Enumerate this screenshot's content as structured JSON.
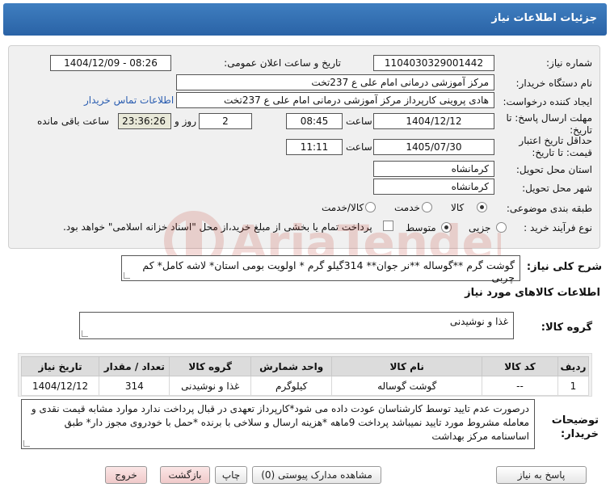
{
  "header": {
    "title": "جزئیات اطلاعات نیاز"
  },
  "form": {
    "need_number_label": "شماره نیاز:",
    "need_number": "1104030329001442",
    "announce_label": "تاریخ و ساعت اعلان عمومی:",
    "announce_value": "1404/12/09 - 08:26",
    "buyer_label": "نام دستگاه خریدار:",
    "buyer_value": "مرکز آموزشی درمانی امام علی ع 237تخت",
    "creator_label": "ایجاد کننده درخواست:",
    "creator_value": "هادی پروینی کارپرداز  مرکز آموزشی درمانی امام علی ع 237تخت",
    "contact_link": "اطلاعات تماس خریدار",
    "deadline_label": "مهلت ارسال پاسخ: تا تاریخ:",
    "deadline_date": "1404/12/12",
    "time_label": "ساعت",
    "deadline_time": "08:45",
    "days_value": "2",
    "days_label": "روز و",
    "remaining_time": "23:36:26",
    "remaining_label": "ساعت باقی مانده",
    "validity_label": "حداقل تاریخ اعتبار قیمت: تا تاریخ:",
    "validity_date": "1405/07/30",
    "validity_time": "11:11",
    "province_label": "استان محل تحویل:",
    "province_value": "کرمانشاه",
    "city_label": "شهر محل تحویل:",
    "city_value": "کرمانشاه",
    "category_label": "طبقه بندی موضوعی:",
    "category_options": [
      "کالا",
      "خدمت",
      "کالا/خدمت"
    ],
    "process_label": "نوع فرآیند خرید :",
    "process_options": [
      "جزیی",
      "متوسط"
    ],
    "payment_note": "پرداخت تمام یا بخشی از مبلغ خرید،از محل \"اسناد خزانه اسلامی\" خواهد بود."
  },
  "description": {
    "label": "شرح کلی نیاز:",
    "text": "گوشت گرم **گوساله **نر جوان**  314گیلو گرم  * اولویت بومی استان* لاشه کامل* کم چربی"
  },
  "goods": {
    "section_title": "اطلاعات کالاهای مورد نیاز",
    "group_label": "گروه کالا:",
    "group_value": "غذا و نوشیدنی",
    "columns": [
      "ردیف",
      "کد کالا",
      "نام کالا",
      "واحد شمارش",
      "گروه کالا",
      "تعداد / مقدار",
      "تاریخ نیاز"
    ],
    "rows": [
      [
        "1",
        "--",
        "گوشت گوساله",
        "کیلوگرم",
        "غذا و نوشیدنی",
        "314",
        "1404/12/12"
      ]
    ]
  },
  "notes": {
    "label": "توضیحات خریدار:",
    "text": "درصورت عدم تایید توسط کارشناسان عودت داده می شود*کارپرداز تعهدی در قبال پرداخت ندارد موارد مشابه قیمت نقدی و معامله مشروط مورد تایید نمیباشد پرداخت 9ماهه *هزینه ارسال  و سلاخی با برنده *حمل با خودروی مجوز دار* طبق اساسنامه مرکز بهداشت"
  },
  "buttons": {
    "reply": "پاسخ به نیاز",
    "docs": "مشاهده مدارک پیوستی (0)",
    "print": "چاپ",
    "back": "بازگشت",
    "exit": "خروج"
  },
  "watermark": {
    "text": "AriaTender.neT"
  },
  "colors": {
    "header": "#2f6db3",
    "link": "#2a5db0",
    "panel": "#f0f0f0"
  }
}
